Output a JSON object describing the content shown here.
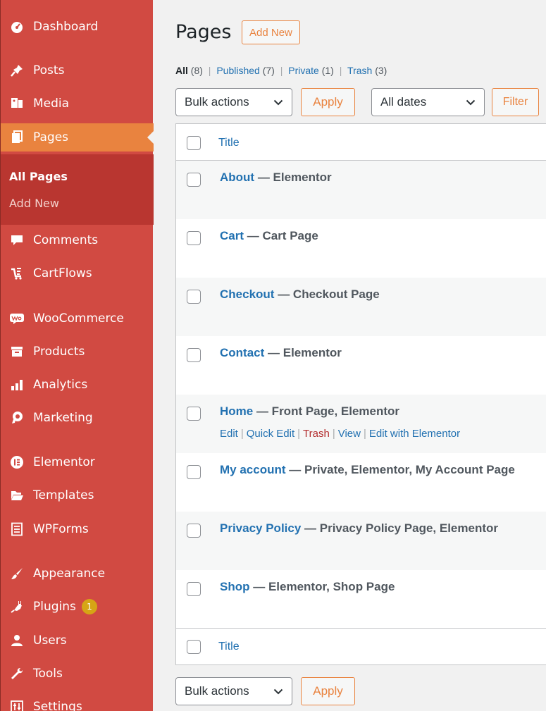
{
  "sidebar": {
    "items": [
      {
        "label": "Dashboard",
        "icon": "dashboard-icon"
      },
      {
        "label": "Posts",
        "icon": "pin-icon"
      },
      {
        "label": "Media",
        "icon": "media-icon"
      },
      {
        "label": "Pages",
        "icon": "pages-icon"
      },
      {
        "label": "Comments",
        "icon": "comments-icon"
      },
      {
        "label": "CartFlows",
        "icon": "cartflows-icon"
      },
      {
        "label": "WooCommerce",
        "icon": "woocommerce-icon"
      },
      {
        "label": "Products",
        "icon": "products-icon"
      },
      {
        "label": "Analytics",
        "icon": "analytics-icon"
      },
      {
        "label": "Marketing",
        "icon": "megaphone-icon"
      },
      {
        "label": "Elementor",
        "icon": "elementor-icon"
      },
      {
        "label": "Templates",
        "icon": "folder-icon"
      },
      {
        "label": "WPForms",
        "icon": "forms-icon"
      },
      {
        "label": "Appearance",
        "icon": "paintbrush-icon"
      },
      {
        "label": "Plugins",
        "icon": "plugin-icon",
        "badge": "1"
      },
      {
        "label": "Users",
        "icon": "users-icon"
      },
      {
        "label": "Tools",
        "icon": "wrench-icon"
      },
      {
        "label": "Settings",
        "icon": "settings-icon"
      }
    ],
    "submenu": {
      "all_pages": "All Pages",
      "add_new": "Add New"
    }
  },
  "header": {
    "title": "Pages",
    "add_new": "Add New"
  },
  "filters": {
    "all": "All",
    "all_count": "(8)",
    "published": "Published",
    "published_count": "(7)",
    "private": "Private",
    "private_count": "(1)",
    "trash": "Trash",
    "trash_count": "(3)",
    "sep": "|"
  },
  "toolbar": {
    "bulk_actions": "Bulk actions",
    "apply": "Apply",
    "all_dates": "All dates",
    "filter": "Filter"
  },
  "table": {
    "column_title": "Title",
    "rows": [
      {
        "title": "About",
        "states": " — Elementor"
      },
      {
        "title": "Cart",
        "states": " — Cart Page"
      },
      {
        "title": "Checkout",
        "states": " — Checkout Page"
      },
      {
        "title": "Contact",
        "states": " — Elementor"
      },
      {
        "title": "Home",
        "states": " — Front Page, Elementor"
      },
      {
        "title": "My account",
        "states": " — Private, Elementor, My Account Page"
      },
      {
        "title": "Privacy Policy",
        "states": " — Privacy Policy Page, Elementor"
      },
      {
        "title": "Shop",
        "states": " — Elementor, Shop Page"
      }
    ],
    "row_actions": {
      "edit": "Edit",
      "quick_edit": "Quick Edit",
      "trash": "Trash",
      "view": "View",
      "edit_with_elementor": "Edit with Elementor"
    }
  },
  "colors": {
    "sidebar": "#d14a42",
    "accent": "#e9833f",
    "link": "#2271b1",
    "trash": "#b32d2e",
    "badge": "#d6a515"
  }
}
